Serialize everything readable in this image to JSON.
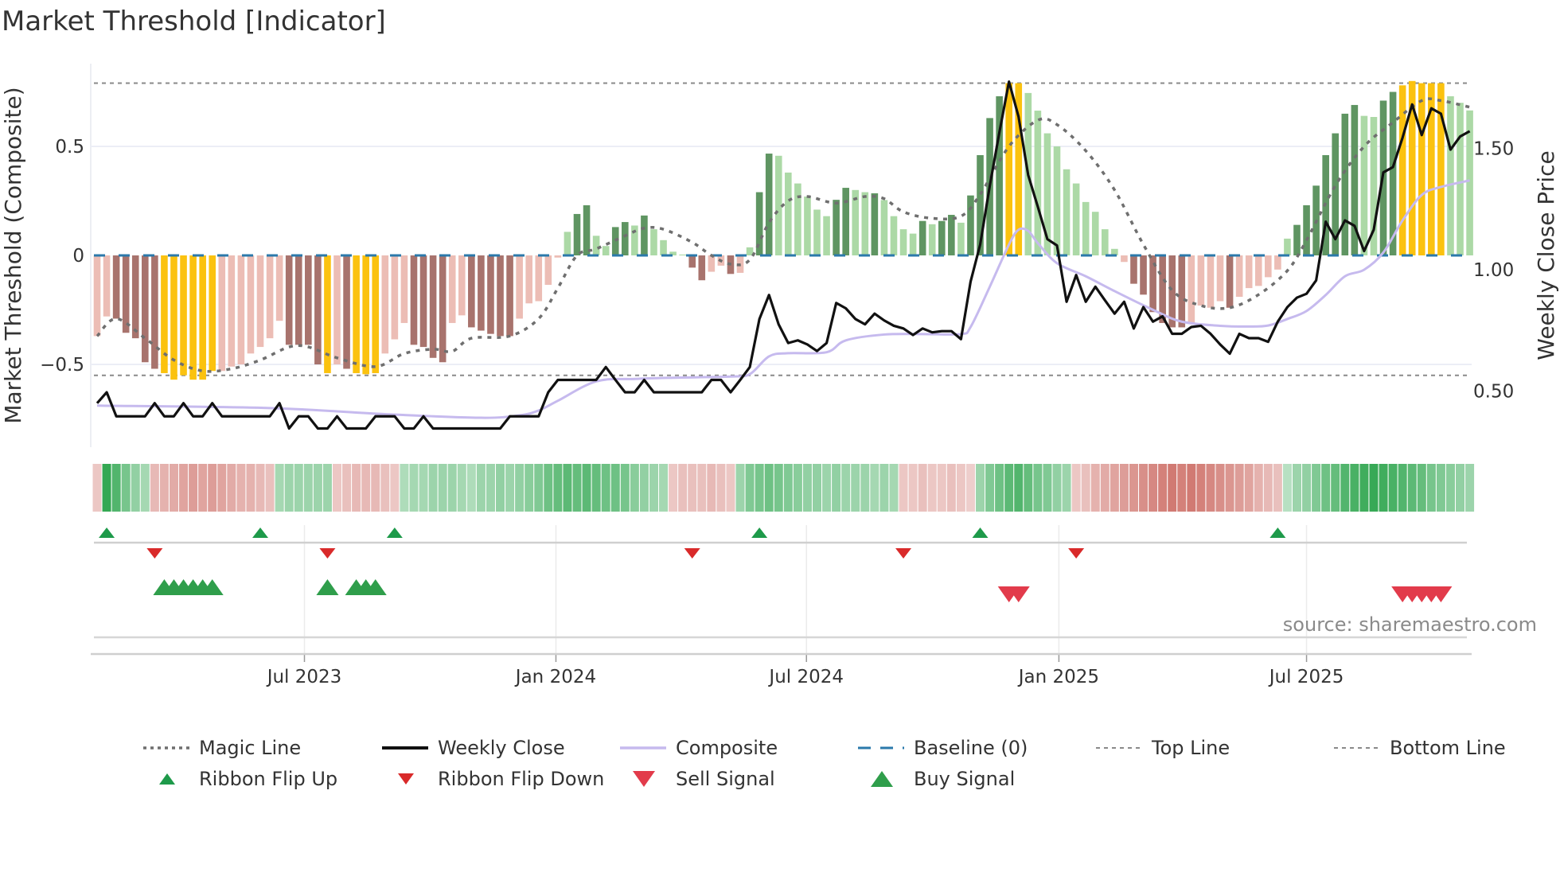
{
  "title": "Market Threshold [Indicator]",
  "source": "source: sharemaestro.com",
  "chart_data": {
    "type": "bar",
    "title": "Market Threshold [Indicator]",
    "ylabel": "Market Threshold (Composite)",
    "ylabel_right": "Weekly Close Price",
    "ylim": [
      -0.8,
      0.85
    ],
    "ylim_right": [
      0.3,
      1.95
    ],
    "grid": true,
    "legend_placement": "bottom",
    "y_ticks": [
      {
        "v": 0.5,
        "label": "0.5"
      },
      {
        "v": 0,
        "label": "0"
      },
      {
        "v": -0.5,
        "label": "−0.5"
      }
    ],
    "y_ticks_right": [
      {
        "v": 1.5,
        "label": "1.50"
      },
      {
        "v": 1.0,
        "label": "1.00"
      },
      {
        "v": 0.5,
        "label": "0.50"
      }
    ],
    "x_unit": "week index (weekly bars)",
    "x_ticks": [
      {
        "week": 21.6,
        "label": "Jul 2023"
      },
      {
        "week": 47.8,
        "label": "Jan 2024"
      },
      {
        "week": 73.9,
        "label": "Jul 2024"
      },
      {
        "week": 100.2,
        "label": "Jan 2025"
      },
      {
        "week": 126.0,
        "label": "Jul 2025"
      }
    ],
    "top_line": 0.79,
    "bottom_line": -0.55,
    "baseline": 0,
    "bar_state_codes": {
      "P": "weak negative",
      "B": "strong negative",
      "Y": "extreme",
      "L": "weak positive",
      "D": "strong positive"
    },
    "bar_states": "PPBBBBBYYYYYYPPPPPPPBBBBYPBYYYPPPBBBBPPBBBBBPPPPPLDDLLDDLDLLLLBBPPBPLDDLLLLLLDDLLDLLLLDLDDLDDDDYYLLLLLLLLLLPBBBBBBPPPPBPPPPPLDDDDDDDLLDDYYYYYLLL",
    "colors": {
      "P": "#ecbdb5",
      "B": "#a8736d",
      "Y": "#fbc20f",
      "L": "#acd9a6",
      "D": "#5f9562",
      "magic": "#6f6f6f",
      "close": "#111111",
      "composite": "#c6baee",
      "baseline": "#2b79ab",
      "refline": "#8a8a8a",
      "buy": "#2f9e4b",
      "sell": "#e23b4b",
      "flip_up": "#1e9a4a",
      "flip_down": "#d92a2a",
      "ribbon_pos": "#34a853",
      "ribbon_neg": "#c9625a"
    },
    "composite_bars": [
      -0.37,
      -0.28,
      -0.29,
      -0.355,
      -0.38,
      -0.49,
      -0.52,
      -0.54,
      -0.57,
      -0.55,
      -0.57,
      -0.57,
      -0.53,
      -0.53,
      -0.51,
      -0.5,
      -0.45,
      -0.42,
      -0.38,
      -0.3,
      -0.41,
      -0.41,
      -0.41,
      -0.5,
      -0.54,
      -0.5,
      -0.52,
      -0.54,
      -0.545,
      -0.54,
      -0.45,
      -0.385,
      -0.31,
      -0.41,
      -0.42,
      -0.47,
      -0.49,
      -0.31,
      -0.275,
      -0.33,
      -0.345,
      -0.36,
      -0.37,
      -0.37,
      -0.29,
      -0.22,
      -0.21,
      -0.135,
      -0.01,
      0.108,
      0.19,
      0.23,
      0.09,
      0.043,
      0.13,
      0.153,
      0.137,
      0.183,
      0.12,
      0.07,
      0.017,
      0.004,
      -0.056,
      -0.114,
      -0.075,
      -0.047,
      -0.085,
      -0.08,
      0.037,
      0.29,
      0.467,
      0.457,
      0.38,
      0.33,
      0.27,
      0.21,
      0.18,
      0.255,
      0.31,
      0.3,
      0.29,
      0.285,
      0.254,
      0.18,
      0.12,
      0.1,
      0.158,
      0.143,
      0.158,
      0.186,
      0.15,
      0.275,
      0.46,
      0.63,
      0.73,
      0.79,
      0.79,
      0.745,
      0.664,
      0.56,
      0.5,
      0.395,
      0.33,
      0.245,
      0.2,
      0.12,
      0.03,
      -0.03,
      -0.13,
      -0.18,
      -0.26,
      -0.31,
      -0.33,
      -0.33,
      -0.31,
      -0.23,
      -0.24,
      -0.21,
      -0.24,
      -0.19,
      -0.15,
      -0.14,
      -0.1,
      -0.065,
      0.077,
      0.14,
      0.23,
      0.32,
      0.46,
      0.56,
      0.65,
      0.69,
      0.64,
      0.635,
      0.71,
      0.75,
      0.78,
      0.8,
      0.79,
      0.79,
      0.79,
      0.73,
      0.7,
      0.665
    ],
    "magic_line": [
      [
        0,
        -0.37
      ],
      [
        2,
        -0.29
      ],
      [
        5,
        -0.38
      ],
      [
        8,
        -0.48
      ],
      [
        11,
        -0.53
      ],
      [
        14,
        -0.52
      ],
      [
        17,
        -0.48
      ],
      [
        20,
        -0.42
      ],
      [
        22,
        -0.42
      ],
      [
        25,
        -0.47
      ],
      [
        29,
        -0.51
      ],
      [
        32,
        -0.45
      ],
      [
        35,
        -0.43
      ],
      [
        37,
        -0.44
      ],
      [
        39,
        -0.38
      ],
      [
        43,
        -0.37
      ],
      [
        46,
        -0.29
      ],
      [
        48,
        -0.15
      ],
      [
        50,
        0.0
      ],
      [
        52,
        0.03
      ],
      [
        55,
        0.09
      ],
      [
        57,
        0.125
      ],
      [
        59,
        0.12
      ],
      [
        62,
        0.06
      ],
      [
        64,
        0.0
      ],
      [
        66,
        -0.04
      ],
      [
        68,
        -0.02
      ],
      [
        70,
        0.15
      ],
      [
        72,
        0.25
      ],
      [
        74,
        0.27
      ],
      [
        77,
        0.24
      ],
      [
        80,
        0.27
      ],
      [
        82,
        0.26
      ],
      [
        84,
        0.2
      ],
      [
        87,
        0.17
      ],
      [
        90,
        0.18
      ],
      [
        92,
        0.28
      ],
      [
        95,
        0.5
      ],
      [
        98,
        0.62
      ],
      [
        100,
        0.6
      ],
      [
        103,
        0.48
      ],
      [
        106,
        0.3
      ],
      [
        109,
        0.05
      ],
      [
        112,
        -0.16
      ],
      [
        115,
        -0.23
      ],
      [
        118,
        -0.24
      ],
      [
        121,
        -0.18
      ],
      [
        124,
        -0.07
      ],
      [
        126,
        0.07
      ],
      [
        129,
        0.32
      ],
      [
        132,
        0.5
      ],
      [
        135,
        0.61
      ],
      [
        138,
        0.71
      ],
      [
        140,
        0.71
      ],
      [
        143,
        0.68
      ]
    ],
    "weekly_close": [
      0.45,
      0.495,
      0.396,
      0.396,
      0.396,
      0.396,
      0.45,
      0.396,
      0.396,
      0.45,
      0.396,
      0.396,
      0.45,
      0.396,
      0.396,
      0.396,
      0.396,
      0.396,
      0.396,
      0.45,
      0.346,
      0.396,
      0.396,
      0.346,
      0.346,
      0.396,
      0.346,
      0.346,
      0.346,
      0.396,
      0.396,
      0.396,
      0.346,
      0.346,
      0.396,
      0.346,
      0.346,
      0.346,
      0.346,
      0.346,
      0.346,
      0.346,
      0.346,
      0.396,
      0.396,
      0.396,
      0.396,
      0.495,
      0.546,
      0.546,
      0.546,
      0.546,
      0.546,
      0.599,
      0.546,
      0.495,
      0.495,
      0.546,
      0.495,
      0.495,
      0.495,
      0.495,
      0.495,
      0.495,
      0.546,
      0.546,
      0.495,
      0.546,
      0.599,
      0.797,
      0.896,
      0.775,
      0.698,
      0.709,
      0.692,
      0.665,
      0.698,
      0.863,
      0.841,
      0.797,
      0.775,
      0.819,
      0.791,
      0.769,
      0.758,
      0.731,
      0.758,
      0.742,
      0.747,
      0.747,
      0.714,
      0.951,
      1.104,
      1.346,
      1.566,
      1.775,
      1.63,
      1.39,
      1.26,
      1.126,
      1.1,
      0.868,
      0.978,
      0.868,
      0.93,
      0.874,
      0.819,
      0.868,
      0.758,
      0.846,
      0.786,
      0.808,
      0.736,
      0.736,
      0.764,
      0.769,
      0.736,
      0.692,
      0.654,
      0.736,
      0.718,
      0.718,
      0.703,
      0.786,
      0.846,
      0.885,
      0.901,
      0.956,
      1.198,
      1.126,
      1.203,
      1.181,
      1.077,
      1.165,
      1.401,
      1.423,
      1.544,
      1.681,
      1.555,
      1.665,
      1.643,
      1.495,
      1.549,
      1.571
    ],
    "composite_line": [
      [
        0,
        0.44
      ],
      [
        18,
        0.43
      ],
      [
        30,
        0.405
      ],
      [
        40,
        0.39
      ],
      [
        44,
        0.4
      ],
      [
        46,
        0.42
      ],
      [
        48,
        0.46
      ],
      [
        52,
        0.54
      ],
      [
        56,
        0.55
      ],
      [
        60,
        0.555
      ],
      [
        66,
        0.56
      ],
      [
        68,
        0.57
      ],
      [
        70,
        0.643
      ],
      [
        72,
        0.656
      ],
      [
        76,
        0.66
      ],
      [
        78,
        0.709
      ],
      [
        82,
        0.733
      ],
      [
        86,
        0.735
      ],
      [
        90,
        0.735
      ],
      [
        91,
        0.764
      ],
      [
        93,
        0.93
      ],
      [
        95,
        1.104
      ],
      [
        96,
        1.165
      ],
      [
        97,
        1.16
      ],
      [
        98,
        1.11
      ],
      [
        100,
        1.027
      ],
      [
        103,
        0.973
      ],
      [
        106,
        0.912
      ],
      [
        110,
        0.835
      ],
      [
        113,
        0.786
      ],
      [
        117,
        0.769
      ],
      [
        120,
        0.766
      ],
      [
        122,
        0.77
      ],
      [
        124,
        0.797
      ],
      [
        126,
        0.83
      ],
      [
        128,
        0.896
      ],
      [
        130,
        0.973
      ],
      [
        132,
        1.0
      ],
      [
        134,
        1.071
      ],
      [
        136,
        1.203
      ],
      [
        138,
        1.308
      ],
      [
        140,
        1.341
      ],
      [
        143,
        1.368
      ]
    ],
    "ribbon": [
      -0.15,
      0.9,
      0.7,
      0.5,
      0.35,
      0.25,
      -0.25,
      -0.3,
      -0.35,
      -0.4,
      -0.45,
      -0.4,
      -0.45,
      -0.4,
      -0.35,
      -0.3,
      -0.3,
      -0.25,
      -0.2,
      0.25,
      0.3,
      0.3,
      0.3,
      0.3,
      0.3,
      -0.15,
      -0.2,
      -0.25,
      -0.25,
      -0.25,
      -0.2,
      -0.15,
      0.2,
      0.25,
      0.25,
      0.3,
      0.3,
      0.3,
      0.25,
      0.2,
      0.3,
      0.3,
      0.35,
      0.3,
      0.35,
      0.4,
      0.45,
      0.55,
      0.6,
      0.65,
      0.6,
      0.65,
      0.6,
      0.55,
      0.55,
      0.5,
      0.4,
      0.35,
      0.3,
      0.25,
      -0.15,
      -0.2,
      -0.2,
      -0.2,
      -0.25,
      -0.2,
      -0.15,
      0.3,
      0.45,
      0.5,
      0.55,
      0.5,
      0.45,
      0.4,
      0.35,
      0.35,
      0.3,
      0.35,
      0.3,
      0.3,
      0.3,
      0.25,
      0.3,
      0.25,
      -0.15,
      -0.15,
      -0.2,
      -0.15,
      -0.15,
      -0.2,
      -0.15,
      -0.1,
      0.3,
      0.45,
      0.55,
      0.65,
      0.7,
      0.6,
      0.5,
      0.45,
      0.35,
      0.3,
      -0.15,
      -0.2,
      -0.3,
      -0.35,
      -0.4,
      -0.45,
      -0.5,
      -0.55,
      -0.6,
      -0.65,
      -0.7,
      -0.65,
      -0.7,
      -0.65,
      -0.6,
      -0.55,
      -0.5,
      -0.45,
      -0.4,
      -0.3,
      -0.25,
      -0.2,
      0.15,
      0.3,
      0.35,
      0.45,
      0.55,
      0.6,
      0.7,
      0.75,
      0.8,
      0.85,
      0.8,
      0.75,
      0.7,
      0.65,
      0.6,
      0.5,
      0.45,
      0.4,
      0.35,
      0.3
    ],
    "ribbon_flip_up": [
      1,
      17,
      31,
      69,
      92,
      123
    ],
    "ribbon_flip_down": [
      6,
      24,
      62,
      84,
      102
    ],
    "buy_signals": [
      7,
      8,
      9,
      10,
      11,
      12,
      24,
      27,
      28,
      29
    ],
    "sell_signals": [
      95,
      96,
      136,
      137,
      138,
      139,
      140
    ]
  },
  "legend": [
    {
      "label": "Magic Line",
      "kind": "dotted",
      "color": "#6f6f6f"
    },
    {
      "label": "Weekly Close",
      "kind": "line",
      "color": "#111111"
    },
    {
      "label": "Composite",
      "kind": "line-light",
      "color": "#c6baee"
    },
    {
      "label": "Baseline (0)",
      "kind": "dashed",
      "color": "#2b79ab"
    },
    {
      "label": "Top Line",
      "kind": "dotted-thin",
      "color": "#8a8a8a"
    },
    {
      "label": "Bottom Line",
      "kind": "dotted-thin",
      "color": "#8a8a8a"
    },
    {
      "label": "Ribbon Flip Up",
      "kind": "tri-up-small",
      "color": "#1e9a4a"
    },
    {
      "label": "Ribbon Flip Down",
      "kind": "tri-down-small",
      "color": "#d92a2a"
    },
    {
      "label": "Sell Signal",
      "kind": "tri-down",
      "color": "#e23b4b"
    },
    {
      "label": "Buy Signal",
      "kind": "tri-up",
      "color": "#2f9e4b"
    }
  ]
}
